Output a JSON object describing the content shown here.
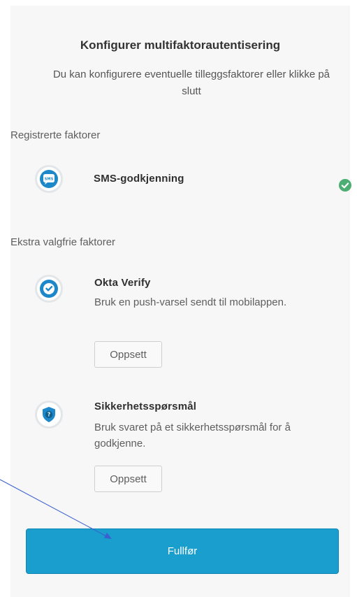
{
  "header": {
    "title": "Konfigurer multifaktorautentisering",
    "subtitle": "Du kan konfigurere eventuelle tilleggsfaktorer eller klikke på slutt"
  },
  "registered": {
    "label": "Registrerte faktorer",
    "factor": {
      "name": "SMS-godkjenning",
      "icon": "sms-icon",
      "badge": "SMS",
      "status_icon": "check-circle-icon"
    }
  },
  "optional": {
    "label": "Ekstra valgfrie faktorer",
    "factors": [
      {
        "name": "Okta Verify",
        "description": "Bruk en push-varsel sendt til mobilappen.",
        "setup_label": "Oppsett",
        "icon": "okta-verify-icon"
      },
      {
        "name": "Sikkerhetsspørsmål",
        "description": "Bruk svaret på et sikkerhetsspørsmål for å godkjenne.",
        "setup_label": "Oppsett",
        "icon": "security-question-icon",
        "icon_glyph": "?"
      }
    ]
  },
  "footer": {
    "finish_label": "Fullfør"
  },
  "colors": {
    "primary": "#1a9ecd",
    "success": "#4cae72",
    "icon_blue": "#1c88c9",
    "background": "#f7f7f7"
  }
}
